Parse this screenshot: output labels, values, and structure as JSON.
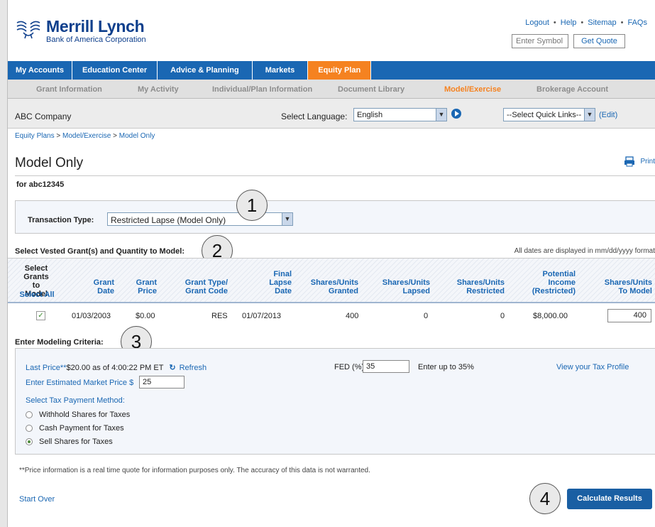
{
  "brand": {
    "name": "Merrill Lynch",
    "subtitle": "Bank of America Corporation"
  },
  "util_links": [
    "Logout",
    "Help",
    "Sitemap",
    "FAQs"
  ],
  "symbol": {
    "placeholder": "Enter Symbol",
    "button": "Get Quote"
  },
  "nav": [
    "My Accounts",
    "Education Center",
    "Advice & Planning",
    "Markets",
    "Equity Plan"
  ],
  "nav_active": "Equity Plan",
  "subnav": [
    "Grant Information",
    "My Activity",
    "Individual/Plan Information",
    "Document Library",
    "Model/Exercise",
    "Brokerage Account"
  ],
  "subnav_active": "Model/Exercise",
  "company": "ABC Company",
  "language": {
    "label": "Select Language:",
    "value": "English"
  },
  "quick_links": {
    "value": "--Select Quick Links--",
    "edit": "(Edit)"
  },
  "breadcrumb": [
    "Equity Plans",
    "Model/Exercise",
    "Model Only"
  ],
  "page_title": "Model Only",
  "print_label": "Print",
  "for_user": "for abc12345",
  "transaction": {
    "label": "Transaction Type:",
    "value": "Restricted Lapse (Model Only)"
  },
  "grants_heading": "Select Vested Grant(s) and Quantity to Model:",
  "date_note": "All dates are displayed in mm/dd/yyyy format",
  "table": {
    "headers": {
      "select": [
        "Select",
        "Grants",
        "to Model"
      ],
      "select_all": "Select All",
      "grant_date": [
        "Grant",
        "Date"
      ],
      "grant_price": [
        "Grant",
        "Price"
      ],
      "grant_type": [
        "Grant Type/",
        "Grant Code"
      ],
      "final_lapse": [
        "Final",
        "Lapse",
        "Date"
      ],
      "shares_granted": [
        "Shares/Units",
        "Granted"
      ],
      "shares_lapsed": [
        "Shares/Units",
        "Lapsed"
      ],
      "shares_restricted": [
        "Shares/Units",
        "Restricted"
      ],
      "potential_income": [
        "Potential",
        "Income",
        "(Restricted)"
      ],
      "shares_to_model": [
        "Shares/Units",
        "To Model"
      ]
    },
    "rows": [
      {
        "grant_date": "01/03/2003",
        "grant_price": "$0.00",
        "grant_type": "RES",
        "final_lapse": "01/07/2013",
        "granted": "400",
        "lapsed": "0",
        "restricted": "0",
        "income": "$8,000.00",
        "to_model": "400"
      }
    ]
  },
  "criteria_heading": "Enter Modeling Criteria:",
  "criteria": {
    "last_price_label": "Last Price**",
    "last_price_text": "$20.00 as of 4:00:22 PM ET",
    "refresh": "Refresh",
    "fed_label": "FED (%)",
    "fed_value": "35",
    "fed_note": "Enter up to 35%",
    "tax_profile_link": "View your Tax Profile",
    "market_price_label": "Enter Estimated Market Price $",
    "market_price_value": "25",
    "tax_method_label": "Select Tax Payment Method:",
    "tax_options": [
      "Withhold Shares for Taxes",
      "Cash Payment for Taxes",
      "Sell Shares for Taxes"
    ],
    "tax_selected_index": 2
  },
  "disclaimer": "**Price information is a real time quote for information purposes only. The accuracy of this data is not warranted.",
  "start_over": "Start Over",
  "calculate": "Calculate Results",
  "callouts": [
    "1",
    "2",
    "3",
    "4"
  ],
  "colors": {
    "brand_blue": "#1a67b3",
    "active_orange": "#f58220",
    "logo_navy": "#0e3f8c"
  }
}
